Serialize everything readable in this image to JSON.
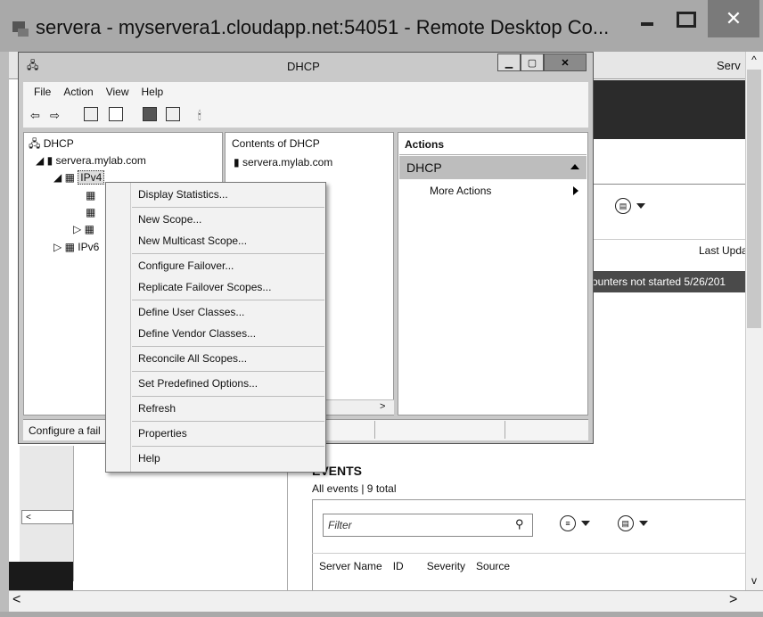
{
  "rdp": {
    "title": "servera - myservera1.cloudapp.net:54051 - Remote Desktop Co...",
    "close_glyph": "✕"
  },
  "background": {
    "server_label": "Serv",
    "last_updated_header": "Last Upda",
    "row_text": "ounters not started   5/26/201",
    "events_title": "EVENTS",
    "events_subtitle": "All events | 9 total",
    "filter_placeholder": "Filter",
    "event_columns": [
      "Server Name",
      "ID",
      "Severity",
      "Source"
    ]
  },
  "dhcp_window": {
    "title": "DHCP",
    "menu": [
      "File",
      "Action",
      "View",
      "Help"
    ],
    "tree": {
      "root": "DHCP",
      "server": "servera.mylab.com",
      "ipv4": "IPv4",
      "ipv6": "IPv6"
    },
    "contents_header": "Contents of DHCP",
    "contents_item": "servera.mylab.com",
    "actions": {
      "header": "Actions",
      "section": "DHCP",
      "more": "More Actions"
    },
    "status_text": "Configure a fail"
  },
  "context_menu": {
    "items": [
      "Display Statistics...",
      "New Scope...",
      "New Multicast Scope...",
      "Configure Failover...",
      "Replicate Failover Scopes...",
      "Define User Classes...",
      "Define Vendor Classes...",
      "Reconcile All Scopes...",
      "Set Predefined Options...",
      "Refresh",
      "Properties",
      "Help"
    ]
  },
  "colors": {
    "rdp_titlebar": "#a9a9a9",
    "menu_background": "#f2f2f2",
    "selected_row": "#4a4a4a"
  }
}
